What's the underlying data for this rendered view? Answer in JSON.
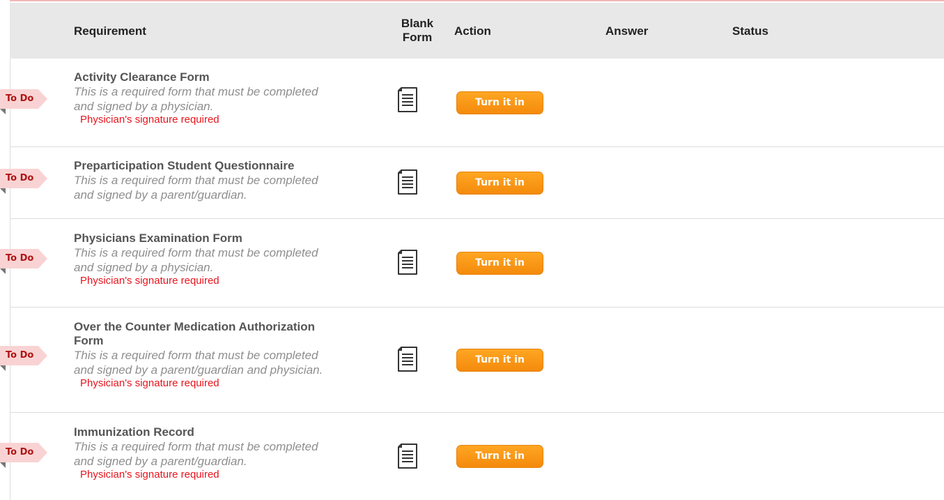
{
  "table": {
    "headers": {
      "requirement": "Requirement",
      "blank_form_line1": "Blank",
      "blank_form_line2": "Form",
      "action": "Action",
      "answer": "Answer",
      "status": "Status"
    },
    "rows": [
      {
        "badge": "To Do",
        "title": "Activity Clearance Form",
        "description_line1": "This is a required form that must be completed",
        "description_line2": "and signed by a physician.",
        "signature_note": "Physician's signature required",
        "button": "Turn it in"
      },
      {
        "badge": "To Do",
        "title": "Preparticipation Student Questionnaire",
        "description_line1": "This is a required form that must be completed",
        "description_line2": "and signed by a parent/guardian.",
        "button": "Turn it in"
      },
      {
        "badge": "To Do",
        "title": "Physicians Examination Form",
        "description_line1": "This is a required form that must be completed",
        "description_line2": "and signed by a physician.",
        "signature_note": "Physician's signature required",
        "button": "Turn it in"
      },
      {
        "badge": "To Do",
        "title_line1": "Over the Counter Medication Authorization",
        "title_line2": "Form",
        "description_line1": "This is a required form that must be completed",
        "description_line2": "and signed by a parent/guardian and physician.",
        "signature_note": "Physician's signature required",
        "button": "Turn it in"
      },
      {
        "badge": "To Do",
        "title": "Immunization Record",
        "description_line1": "This is a required form that must be completed",
        "description_line2": "and signed by a parent/guardian.",
        "signature_note": "Physician's signature required",
        "button": "Turn it in"
      }
    ]
  },
  "icons": {
    "blank_form": "document-icon",
    "badge_fold": "ribbon-fold-icon"
  },
  "colors": {
    "header_bg": "#e8e8e8",
    "badge_bg": "#f9d3d3",
    "badge_text": "#b01414",
    "signature_note": "#e8141c",
    "button_bg": "#f7941d",
    "top_accent": "#f3b8b8"
  }
}
